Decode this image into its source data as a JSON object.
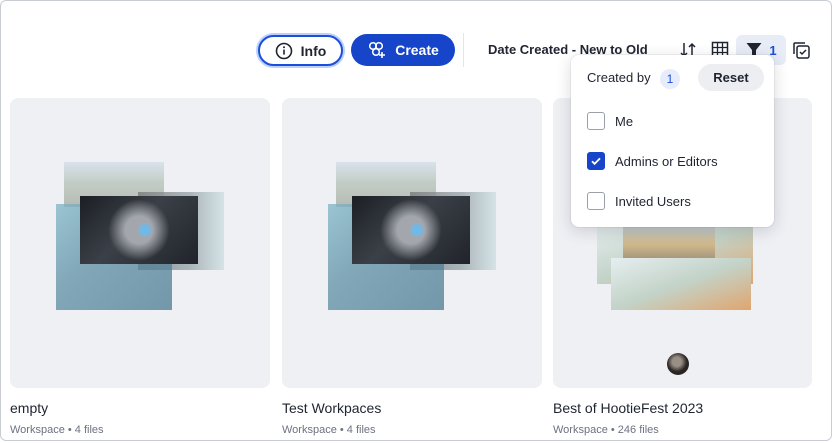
{
  "toolbar": {
    "info_label": "Info",
    "create_label": "Create",
    "sort_label": "Date Created - New to Old",
    "filter_count": "1"
  },
  "filter_dropdown": {
    "heading": "Created by",
    "badge": "1",
    "reset_label": "Reset",
    "options": [
      {
        "label": "Me",
        "checked": false
      },
      {
        "label": "Admins or Editors",
        "checked": true
      },
      {
        "label": "Invited Users",
        "checked": false
      }
    ]
  },
  "cards": [
    {
      "title": "empty",
      "subtitle": "Workspace • 4 files"
    },
    {
      "title": "Test Workpaces",
      "subtitle": "Workspace • 4 files"
    },
    {
      "title": "Best of HootieFest 2023",
      "subtitle": "Workspace • 246 files"
    }
  ],
  "colors": {
    "accent": "#1745c9",
    "card_bg": "#eef0f4"
  },
  "icons": [
    "info-icon",
    "create-icon",
    "sort-icon",
    "grid-view-icon",
    "filter-icon",
    "select-icon",
    "checkmark-icon"
  ]
}
